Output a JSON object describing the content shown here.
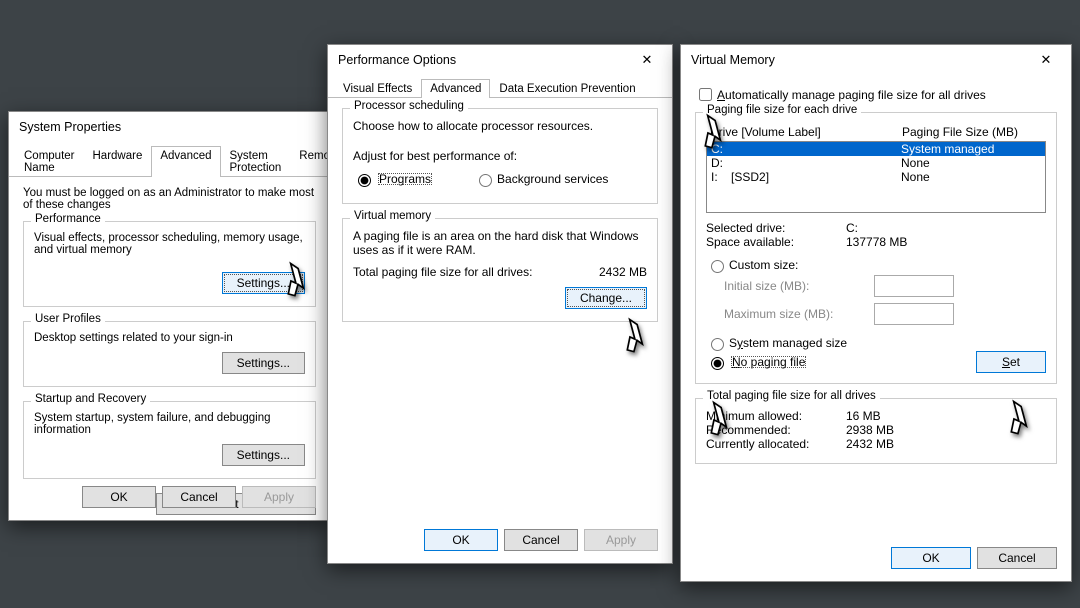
{
  "sysprops": {
    "title": "System Properties",
    "tabs": [
      "Computer Name",
      "Hardware",
      "Advanced",
      "System Protection",
      "Remote"
    ],
    "admin_note": "You must be logged on as an Administrator to make most of these changes",
    "perf": {
      "title": "Performance",
      "desc": "Visual effects, processor scheduling, memory usage, and virtual memory",
      "btn": "Settings..."
    },
    "profiles": {
      "title": "User Profiles",
      "desc": "Desktop settings related to your sign-in",
      "btn": "Settings..."
    },
    "startup": {
      "title": "Startup and Recovery",
      "desc": "System startup, system failure, and debugging information",
      "btn": "Settings..."
    },
    "envvars_btn": "Environment Variables...",
    "ok": "OK",
    "cancel": "Cancel",
    "apply": "Apply"
  },
  "perfopt": {
    "title": "Performance Options",
    "tabs": [
      "Visual Effects",
      "Advanced",
      "Data Execution Prevention"
    ],
    "sched": {
      "title": "Processor scheduling",
      "desc": "Choose how to allocate processor resources.",
      "adjust": "Adjust for best performance of:",
      "opt1": "Programs",
      "opt2": "Background services"
    },
    "vm": {
      "title": "Virtual memory",
      "desc": "A paging file is an area on the hard disk that Windows uses as if it were RAM.",
      "total_lbl": "Total paging file size for all drives:",
      "total_val": "2432 MB",
      "btn": "Change..."
    },
    "ok": "OK",
    "cancel": "Cancel",
    "apply": "Apply"
  },
  "vmem": {
    "title": "Virtual Memory",
    "auto": "Automatically manage paging file size for all drives",
    "eachdrive_lbl": "Paging file size for each drive",
    "col1": "Drive [Volume Label]",
    "col2": "Paging File Size (MB)",
    "drives": [
      {
        "vol": "C:",
        "label": "",
        "pf": "System managed"
      },
      {
        "vol": "D:",
        "label": "",
        "pf": "None"
      },
      {
        "vol": "I:",
        "label": "[SSD2]",
        "pf": "None"
      }
    ],
    "sel_drive_lbl": "Selected drive:",
    "sel_drive_val": "C:",
    "space_lbl": "Space available:",
    "space_val": "137778 MB",
    "custom": "Custom size:",
    "init": "Initial size (MB):",
    "max": "Maximum size (MB):",
    "sysmanaged": "System managed size",
    "nopaging": "No paging file",
    "set": "Set",
    "totals_title": "Total paging file size for all drives",
    "min_lbl": "Minimum allowed:",
    "min_val": "16 MB",
    "rec_lbl": "Recommended:",
    "rec_val": "2938 MB",
    "cur_lbl": "Currently allocated:",
    "cur_val": "2432 MB",
    "ok": "OK",
    "cancel": "Cancel"
  }
}
